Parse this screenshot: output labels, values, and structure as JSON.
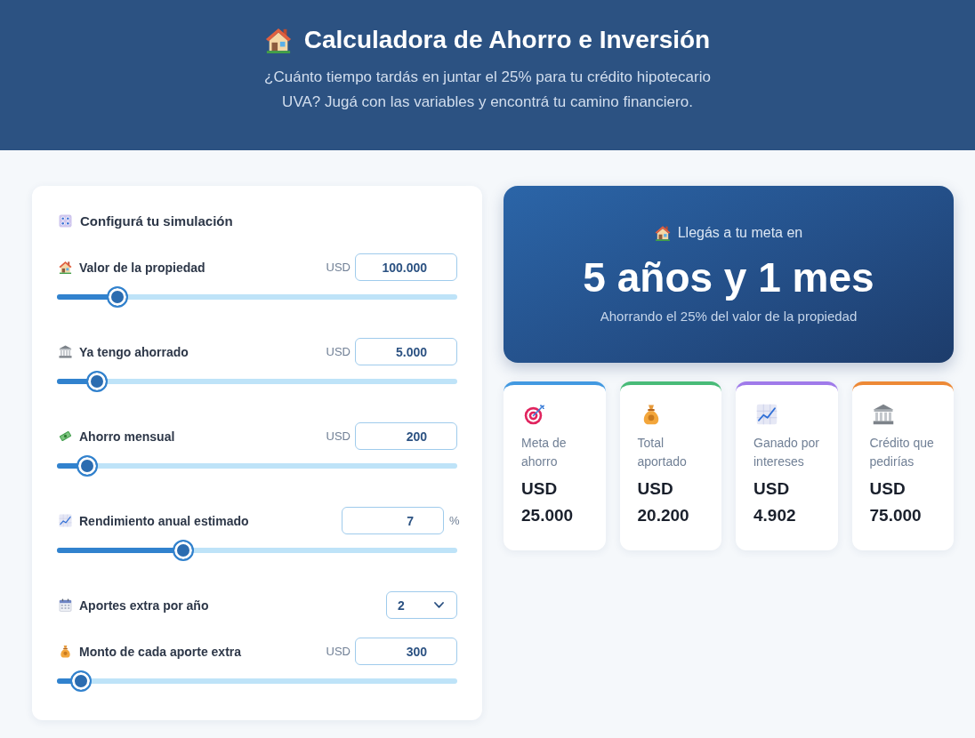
{
  "header": {
    "title": "Calculadora de Ahorro e Inversión",
    "subtitle": "¿Cuánto tiempo tardás en juntar el 25% para tu crédito hipotecario UVA? Jugá con las variables y encontrá tu camino financiero."
  },
  "settings": {
    "title": "Configurá tu simulación",
    "fields": [
      {
        "kind": "slider",
        "label": "Valor de la propiedad",
        "prefix": "USD",
        "value": "100.000",
        "level": 0.15
      },
      {
        "kind": "slider",
        "label": "Ya tengo ahorrado",
        "prefix": "USD",
        "value": "5.000",
        "level": 0.1
      },
      {
        "kind": "slider",
        "label": "Ahorro mensual",
        "prefix": "USD",
        "value": "200",
        "level": 0.075
      },
      {
        "kind": "slider",
        "label": "Rendimiento anual estimado",
        "suffix": "%",
        "value": "7",
        "level": 0.315
      },
      {
        "kind": "select",
        "label": "Aportes extra por año",
        "value": "2"
      },
      {
        "kind": "slider",
        "label": "Monto de cada aporte extra",
        "prefix": "USD",
        "value": "300",
        "level": 0.06
      }
    ]
  },
  "result": {
    "label": "Llegás a tu meta en",
    "duration": "5 años y 1 mes",
    "note": "Ahorrando el 25% del valor de la propiedad"
  },
  "stats": [
    {
      "label": "Meta de ahorro",
      "value": "USD 25.000",
      "color": "#4299e1"
    },
    {
      "label": "Total aportado",
      "value": "USD 20.200",
      "color": "#48bb78"
    },
    {
      "label": "Ganado por intereses",
      "value": "USD 4.902",
      "color": "#9f7aea"
    },
    {
      "label": "Crédito que pedirías",
      "value": "USD 75.000",
      "color": "#ed8936"
    }
  ]
}
